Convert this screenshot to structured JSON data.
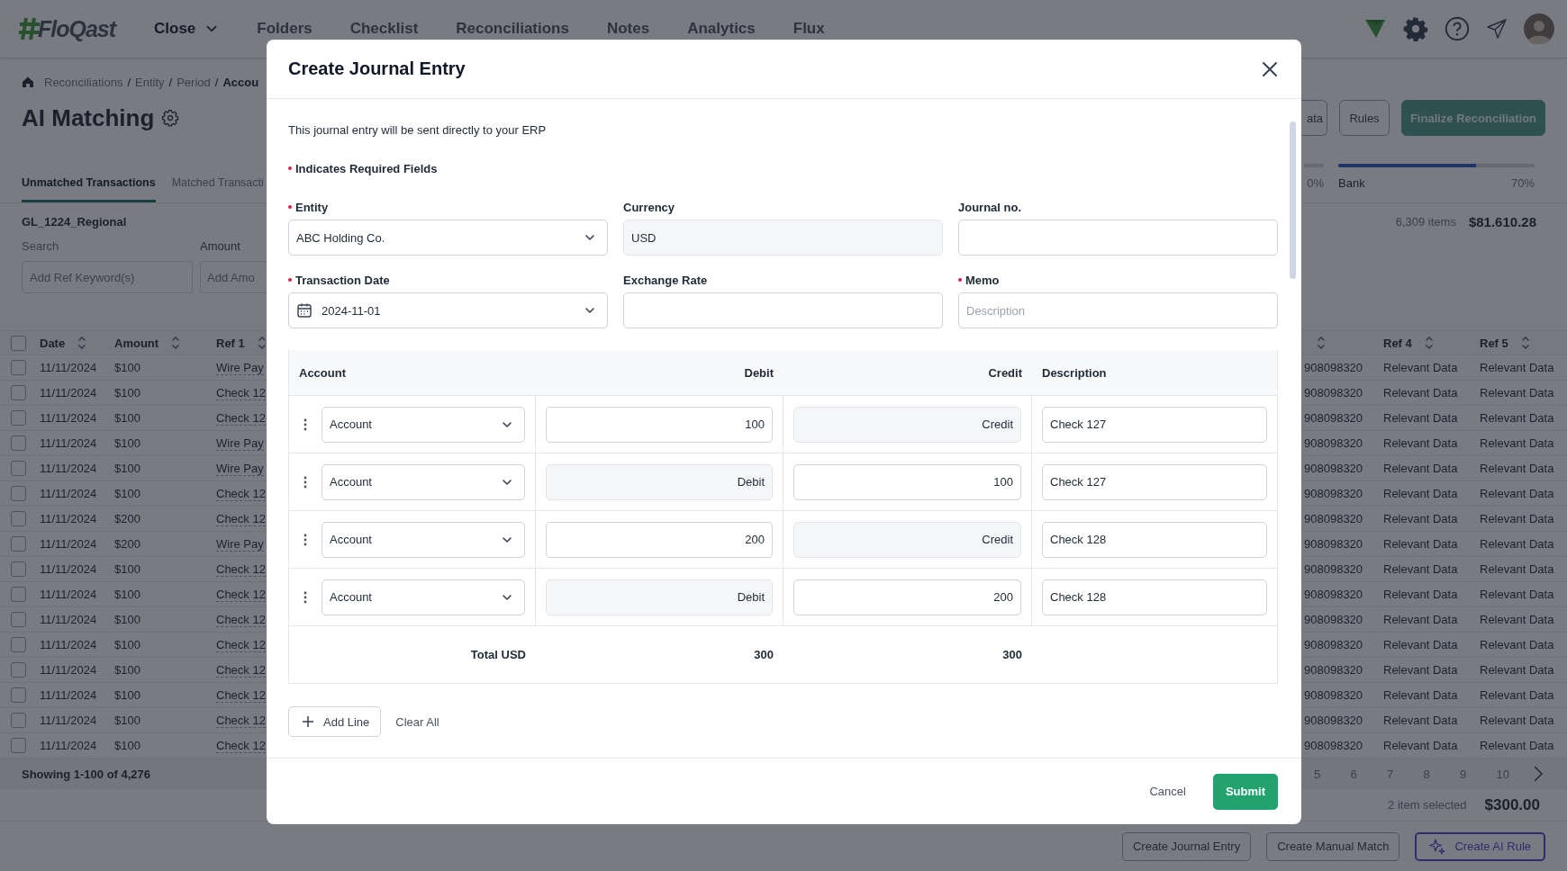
{
  "top_nav": {
    "logo": "FloQast",
    "items": [
      {
        "label": "Close",
        "selected": true,
        "dropdown": true
      },
      {
        "label": "Folders",
        "selected": false,
        "dropdown": false
      },
      {
        "label": "Checklist",
        "selected": false,
        "dropdown": false
      },
      {
        "label": "Reconciliations",
        "selected": false,
        "dropdown": false
      },
      {
        "label": "Notes",
        "selected": false,
        "dropdown": false
      },
      {
        "label": "Analytics",
        "selected": false,
        "dropdown": false
      },
      {
        "label": "Flux",
        "selected": false,
        "dropdown": false
      }
    ]
  },
  "page": {
    "breadcrumb": [
      {
        "label": "Reconciliations",
        "separator": "/",
        "current": false
      },
      {
        "label": "Entity",
        "separator": "/",
        "current": false
      },
      {
        "label": "Period",
        "separator": "/",
        "current": false
      },
      {
        "label": "Accou",
        "current": true
      }
    ],
    "title": "AI Matching",
    "header_buttons": [
      {
        "label": "ata",
        "kind": "outline",
        "disabled": false
      },
      {
        "label": "Rules",
        "kind": "outline",
        "disabled": false
      },
      {
        "label": "Finalize Reconciliation",
        "kind": "primary",
        "disabled": true
      }
    ],
    "tabs": [
      {
        "label": "Unmatched Transactions",
        "selected": true
      },
      {
        "label": "Matched Transacti",
        "selected": false
      }
    ],
    "progress": [
      {
        "reading": "0%"
      },
      {
        "label": "Bank",
        "level": 0.7,
        "reading": "70%"
      }
    ],
    "dataset": "GL_1224_Regional",
    "summary": {
      "items": "6,309 items",
      "total": "$81.610.28"
    },
    "filters": [
      {
        "label": "Search",
        "placeholder": "Add Ref Keyword(s)"
      },
      {
        "label": "Amount",
        "placeholder": "Add Amo"
      }
    ],
    "table": {
      "select_all_checked": false,
      "columns": [
        {
          "label": "Date",
          "sortable": true
        },
        {
          "label": "Amount",
          "sortable": true
        },
        {
          "label": "Ref 1",
          "sortable": true
        },
        {
          "sortable": true
        },
        {
          "label": "Ref 4",
          "sortable": true
        },
        {
          "label": "Ref 5",
          "sortable": true
        }
      ],
      "rows": [
        {
          "checked": false,
          "cells": [
            "11/11/2024",
            "$100",
            "Wire Pay",
            "908098320",
            "Relevant Data",
            "Relevant Data"
          ]
        },
        {
          "checked": false,
          "cells": [
            "11/11/2024",
            "$100",
            "Check 12",
            "908098320",
            "Relevant Data",
            "Relevant Data"
          ]
        },
        {
          "checked": false,
          "cells": [
            "11/11/2024",
            "$100",
            "Check 12",
            "908098320",
            "Relevant Data",
            "Relevant Data"
          ]
        },
        {
          "checked": false,
          "cells": [
            "11/11/2024",
            "$100",
            "Wire Pay",
            "908098320",
            "Relevant Data",
            "Relevant Data"
          ]
        },
        {
          "checked": false,
          "cells": [
            "11/11/2024",
            "$100",
            "Wire Pay",
            "908098320",
            "Relevant Data",
            "Relevant Data"
          ]
        },
        {
          "checked": false,
          "cells": [
            "11/11/2024",
            "$100",
            "Check 12",
            "908098320",
            "Relevant Data",
            "Relevant Data"
          ]
        },
        {
          "checked": false,
          "cells": [
            "11/11/2024",
            "$200",
            "Check 12",
            "908098320",
            "Relevant Data",
            "Relevant Data"
          ]
        },
        {
          "checked": false,
          "cells": [
            "11/11/2024",
            "$200",
            "Wire Pay",
            "908098320",
            "Relevant Data",
            "Relevant Data"
          ]
        },
        {
          "checked": false,
          "cells": [
            "11/11/2024",
            "$100",
            "Check 12",
            "908098320",
            "Relevant Data",
            "Relevant Data"
          ]
        },
        {
          "checked": false,
          "cells": [
            "11/11/2024",
            "$100",
            "Check 12",
            "908098320",
            "Relevant Data",
            "Relevant Data"
          ]
        },
        {
          "checked": false,
          "cells": [
            "11/11/2024",
            "$100",
            "Check 12",
            "908098320",
            "Relevant Data",
            "Relevant Data"
          ]
        },
        {
          "checked": false,
          "cells": [
            "11/11/2024",
            "$100",
            "Check 12",
            "908098320",
            "Relevant Data",
            "Relevant Data"
          ]
        },
        {
          "checked": false,
          "cells": [
            "11/11/2024",
            "$100",
            "Check 12",
            "908098320",
            "Relevant Data",
            "Relevant Data"
          ]
        },
        {
          "checked": false,
          "cells": [
            "11/11/2024",
            "$100",
            "Check 12",
            "908098320",
            "Relevant Data",
            "Relevant Data"
          ]
        },
        {
          "checked": false,
          "cells": [
            "11/11/2024",
            "$100",
            "Check 12",
            "908098320",
            "Relevant Data",
            "Relevant Data"
          ]
        },
        {
          "checked": false,
          "cells": [
            "11/11/2024",
            "$100",
            "Check 12",
            "908098320",
            "Relevant Data",
            "Relevant Data"
          ]
        }
      ]
    },
    "pagination": {
      "summary": "Showing 1-100 of 4,276",
      "pages": [
        {
          "label": "5",
          "selected": false
        },
        {
          "label": "6",
          "selected": false
        },
        {
          "label": "7",
          "selected": false
        },
        {
          "label": "8",
          "selected": false
        },
        {
          "label": "9",
          "selected": false
        },
        {
          "label": "10",
          "selected": false
        }
      ]
    },
    "selection": {
      "count": "2 item selected",
      "total": "$300.00"
    },
    "actions": [
      {
        "label": "Create Journal Entry",
        "kind": "outline"
      },
      {
        "label": "Create Manual Match",
        "kind": "outline"
      },
      {
        "label": "Create AI Rule",
        "kind": "ai"
      }
    ]
  },
  "modal": {
    "title": "Create Journal Entry",
    "intro": "This journal entry will be sent directly to your ERP",
    "required_note": "Indicates Required Fields",
    "fields": [
      {
        "label": "Entity",
        "required": true,
        "kind": "select",
        "value": "ABC Holding Co.",
        "disabled": false
      },
      {
        "label": "Currency",
        "required": false,
        "kind": "text",
        "value": "USD",
        "disabled": true
      },
      {
        "label": "Journal no.",
        "required": false,
        "kind": "text",
        "disabled": false
      },
      {
        "label": "Transaction Date",
        "required": true,
        "kind": "date",
        "value": "2024-11-01",
        "disabled": false
      },
      {
        "label": "Exchange Rate",
        "required": false,
        "kind": "text",
        "disabled": false
      },
      {
        "label": "Memo",
        "required": true,
        "kind": "text",
        "placeholder": "Description",
        "disabled": false
      }
    ],
    "lines_table": {
      "columns": [
        "Account",
        "Debit",
        "Credit",
        "Description"
      ],
      "lines": [
        {
          "account": "Account",
          "debit": {
            "value": "100",
            "disabled": false
          },
          "credit": {
            "placeholder": "Credit",
            "disabled": true
          },
          "description": "Check 127"
        },
        {
          "account": "Account",
          "debit": {
            "placeholder": "Debit",
            "disabled": true
          },
          "credit": {
            "value": "100",
            "disabled": false
          },
          "description": "Check 127"
        },
        {
          "account": "Account",
          "debit": {
            "value": "200",
            "disabled": false
          },
          "credit": {
            "placeholder": "Credit",
            "disabled": true
          },
          "description": "Check 128"
        },
        {
          "account": "Account",
          "debit": {
            "placeholder": "Debit",
            "disabled": true
          },
          "credit": {
            "value": "200",
            "disabled": false
          },
          "description": "Check 128"
        }
      ],
      "total": {
        "label": "Total USD",
        "debit": "300",
        "credit": "300"
      }
    },
    "add_line": "Add Line",
    "clear_all": "Clear All",
    "cancel": "Cancel",
    "submit": "Submit"
  }
}
